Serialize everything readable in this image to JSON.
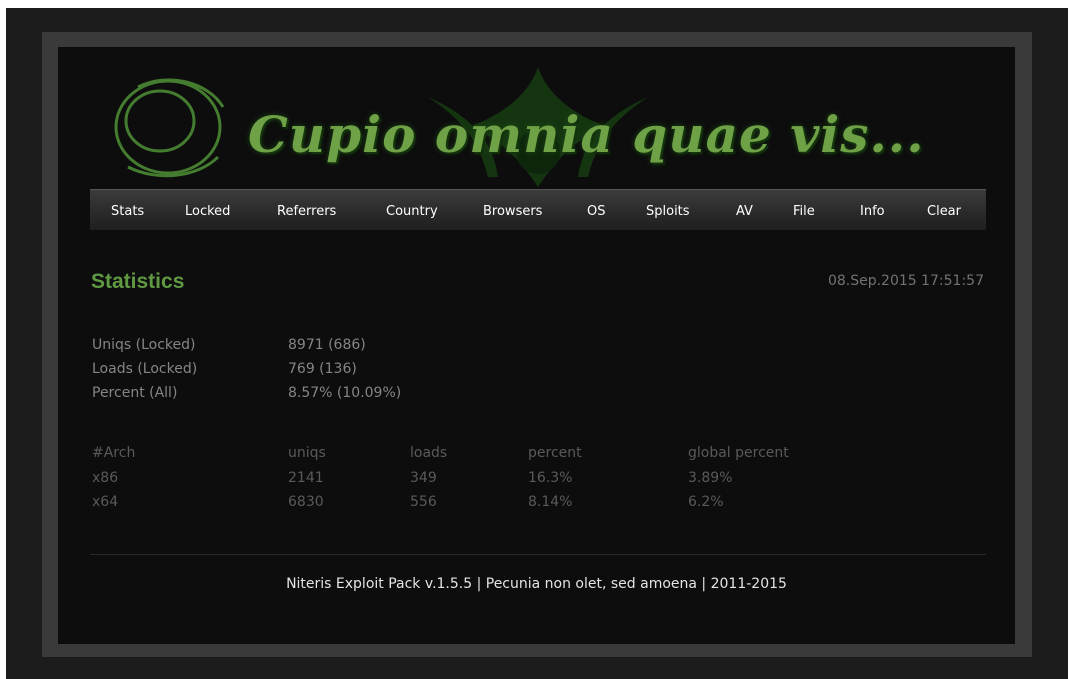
{
  "banner": {
    "motto": "Cupio omnia quae vis..."
  },
  "nav": {
    "items": [
      "Stats",
      "Locked",
      "Referrers",
      "Country",
      "Browsers",
      "OS",
      "Sploits",
      "AV",
      "File",
      "Info",
      "Clear"
    ]
  },
  "page": {
    "title": "Statistics",
    "datetime": "08.Sep.2015 17:51:57"
  },
  "summary": [
    {
      "label": "Uniqs (Locked)",
      "value": "8971 (686)"
    },
    {
      "label": "Loads (Locked)",
      "value": "769 (136)"
    },
    {
      "label": "Percent (All)",
      "value": "8.57% (10.09%)"
    }
  ],
  "arch_table": {
    "headers": [
      "#Arch",
      "uniqs",
      "loads",
      "percent",
      "global percent"
    ],
    "rows": [
      [
        "x86",
        "2141",
        "349",
        "16.3%",
        "3.89%"
      ],
      [
        "x64",
        "6830",
        "556",
        "8.14%",
        "6.2%"
      ]
    ]
  },
  "footer": {
    "text": "Niteris Exploit Pack v.1.5.5 | Pecunia non olet, sed amoena | 2011-2015"
  },
  "colors": {
    "accent_green": "#5f9a42",
    "background": "#0d0d0d",
    "frame": "#3a3a3a"
  }
}
